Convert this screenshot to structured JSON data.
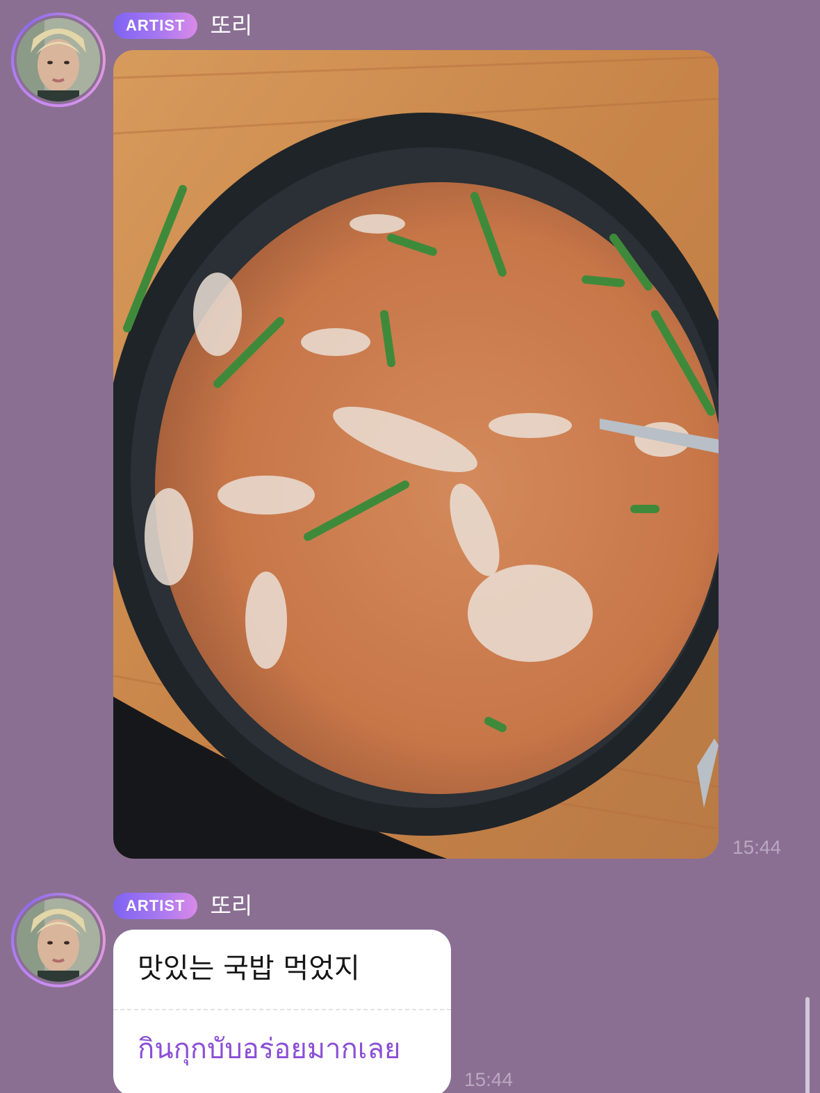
{
  "messages": [
    {
      "badge": "ARTIST",
      "sender": "또리",
      "time": "15:44",
      "photo_alt": "",
      "colors": {
        "bowl": "#1e2226",
        "soup": "#c97a4e",
        "table": "#d49658"
      }
    },
    {
      "badge": "ARTIST",
      "sender": "또리",
      "text": "맛있는 국밥 먹었지",
      "translation": "กินกุกบับอร่อยมากเลย",
      "time": "15:44"
    }
  ],
  "theme": {
    "background": "#8a6f93",
    "badge_gradient": [
      "#7f63f3",
      "#d98ae8"
    ],
    "translation_color": "#8b4fd6"
  }
}
